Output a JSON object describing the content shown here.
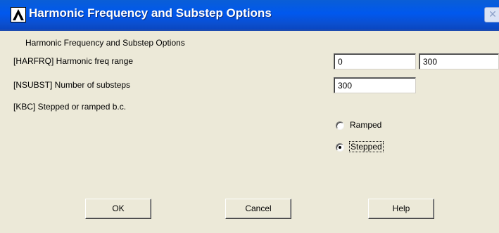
{
  "window": {
    "title": "Harmonic Frequency and Substep Options",
    "close_glyph": "✕",
    "icon": "ansys-logo-icon"
  },
  "dialog": {
    "heading": "Harmonic Frequency and Substep Options",
    "harfrq": {
      "label": "[HARFRQ]  Harmonic freq range",
      "start_value": "0",
      "end_value": "300"
    },
    "nsubst": {
      "label": "[NSUBST]  Number of substeps",
      "value": "300"
    },
    "kbc": {
      "label": "[KBC]     Stepped or ramped b.c.",
      "options": [
        {
          "label": "Ramped",
          "selected": false
        },
        {
          "label": "Stepped",
          "selected": true
        }
      ]
    }
  },
  "buttons": {
    "ok": "OK",
    "cancel": "Cancel",
    "help": "Help"
  },
  "colors": {
    "title_bar": "#0058ee",
    "dialog_bg": "#ece9d8"
  }
}
